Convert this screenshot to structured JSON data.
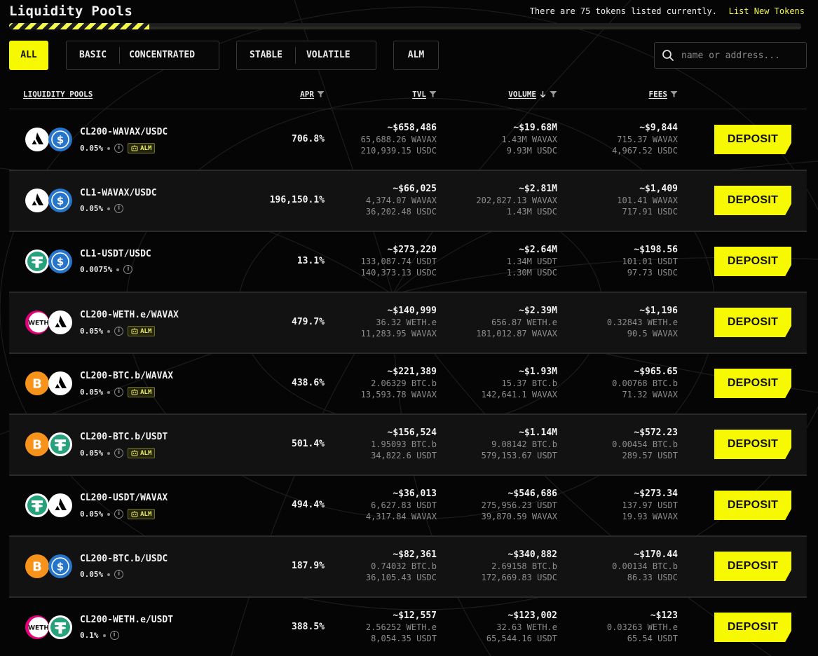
{
  "header": {
    "title": "Liquidity Pools",
    "token_count_text": "There are 75 tokens listed currently.",
    "list_new_tokens": "List New Tokens"
  },
  "filters": {
    "all": "ALL",
    "basic": "BASIC",
    "concentrated": "CONCENTRATED",
    "stable": "STABLE",
    "volatile": "VOLATILE",
    "alm": "ALM",
    "active": "all"
  },
  "search": {
    "placeholder": "name or address..."
  },
  "columns": {
    "pools": "LIQUIDITY POOLS",
    "apr": "APR",
    "tvl": "TVL",
    "volume": "VOLUME",
    "fees": "FEES"
  },
  "deposit_label": "DEPOSIT",
  "alm_badge": "ALM",
  "colors": {
    "accent": "#f7f900",
    "avax": "#ffffff",
    "usdc": "#2775ca",
    "usdt": "#26a17b",
    "btc": "#f7931a",
    "weth": "#e4007a"
  },
  "pools": [
    {
      "name": "CL200-WAVAX/USDC",
      "fee": "0.05%",
      "alm": true,
      "tokens": [
        "avax",
        "usdc"
      ],
      "apr": "706.8%",
      "tvl": "~$658,486",
      "tvl_a": "65,688.26 WAVAX",
      "tvl_b": "210,939.15 USDC",
      "vol": "~$19.68M",
      "vol_a": "1.43M WAVAX",
      "vol_b": "9.93M USDC",
      "fees": "~$9,844",
      "fees_a": "715.37 WAVAX",
      "fees_b": "4,967.52 USDC"
    },
    {
      "name": "CL1-WAVAX/USDC",
      "fee": "0.05%",
      "alm": false,
      "tokens": [
        "avax",
        "usdc"
      ],
      "apr": "196,150.1%",
      "tvl": "~$66,025",
      "tvl_a": "4,374.07 WAVAX",
      "tvl_b": "36,202.48 USDC",
      "vol": "~$2.81M",
      "vol_a": "202,827.13 WAVAX",
      "vol_b": "1.43M USDC",
      "fees": "~$1,409",
      "fees_a": "101.41 WAVAX",
      "fees_b": "717.91 USDC"
    },
    {
      "name": "CL1-USDT/USDC",
      "fee": "0.0075%",
      "alm": false,
      "tokens": [
        "usdt",
        "usdc"
      ],
      "apr": "13.1%",
      "tvl": "~$273,220",
      "tvl_a": "133,087.74 USDT",
      "tvl_b": "140,373.13 USDC",
      "vol": "~$2.64M",
      "vol_a": "1.34M USDT",
      "vol_b": "1.30M USDC",
      "fees": "~$198.56",
      "fees_a": "101.01 USDT",
      "fees_b": "97.73 USDC"
    },
    {
      "name": "CL200-WETH.e/WAVAX",
      "fee": "0.05%",
      "alm": true,
      "tokens": [
        "weth",
        "avax"
      ],
      "apr": "479.7%",
      "tvl": "~$140,999",
      "tvl_a": "36.32 WETH.e",
      "tvl_b": "11,283.95 WAVAX",
      "vol": "~$2.39M",
      "vol_a": "656.87 WETH.e",
      "vol_b": "181,012.87 WAVAX",
      "fees": "~$1,196",
      "fees_a": "0.32843 WETH.e",
      "fees_b": "90.5 WAVAX"
    },
    {
      "name": "CL200-BTC.b/WAVAX",
      "fee": "0.05%",
      "alm": true,
      "tokens": [
        "btc",
        "avax"
      ],
      "apr": "438.6%",
      "tvl": "~$221,389",
      "tvl_a": "2.06329 BTC.b",
      "tvl_b": "13,593.78 WAVAX",
      "vol": "~$1.93M",
      "vol_a": "15.37 BTC.b",
      "vol_b": "142,641.1 WAVAX",
      "fees": "~$965.65",
      "fees_a": "0.00768 BTC.b",
      "fees_b": "71.32 WAVAX"
    },
    {
      "name": "CL200-BTC.b/USDT",
      "fee": "0.05%",
      "alm": true,
      "tokens": [
        "btc",
        "usdt"
      ],
      "apr": "501.4%",
      "tvl": "~$156,524",
      "tvl_a": "1.95093 BTC.b",
      "tvl_b": "34,822.6 USDT",
      "vol": "~$1.14M",
      "vol_a": "9.08142 BTC.b",
      "vol_b": "579,153.67 USDT",
      "fees": "~$572.23",
      "fees_a": "0.00454 BTC.b",
      "fees_b": "289.57 USDT"
    },
    {
      "name": "CL200-USDT/WAVAX",
      "fee": "0.05%",
      "alm": true,
      "tokens": [
        "usdt",
        "avax"
      ],
      "apr": "494.4%",
      "tvl": "~$36,013",
      "tvl_a": "6,627.83 USDT",
      "tvl_b": "4,317.84 WAVAX",
      "vol": "~$546,686",
      "vol_a": "275,956.23 USDT",
      "vol_b": "39,870.59 WAVAX",
      "fees": "~$273.34",
      "fees_a": "137.97 USDT",
      "fees_b": "19.93 WAVAX"
    },
    {
      "name": "CL200-BTC.b/USDC",
      "fee": "0.05%",
      "alm": false,
      "tokens": [
        "btc",
        "usdc"
      ],
      "apr": "187.9%",
      "tvl": "~$82,361",
      "tvl_a": "0.74032 BTC.b",
      "tvl_b": "36,105.43 USDC",
      "vol": "~$340,882",
      "vol_a": "2.69158 BTC.b",
      "vol_b": "172,669.83 USDC",
      "fees": "~$170.44",
      "fees_a": "0.00134 BTC.b",
      "fees_b": "86.33 USDC"
    },
    {
      "name": "CL200-WETH.e/USDT",
      "fee": "0.1%",
      "alm": false,
      "tokens": [
        "weth",
        "usdt"
      ],
      "apr": "388.5%",
      "tvl": "~$12,557",
      "tvl_a": "2.56252 WETH.e",
      "tvl_b": "8,054.35 USDT",
      "vol": "~$123,002",
      "vol_a": "32.63 WETH.e",
      "vol_b": "65,544.16 USDT",
      "fees": "~$123",
      "fees_a": "0.03263 WETH.e",
      "fees_b": "65.54 USDT"
    }
  ]
}
